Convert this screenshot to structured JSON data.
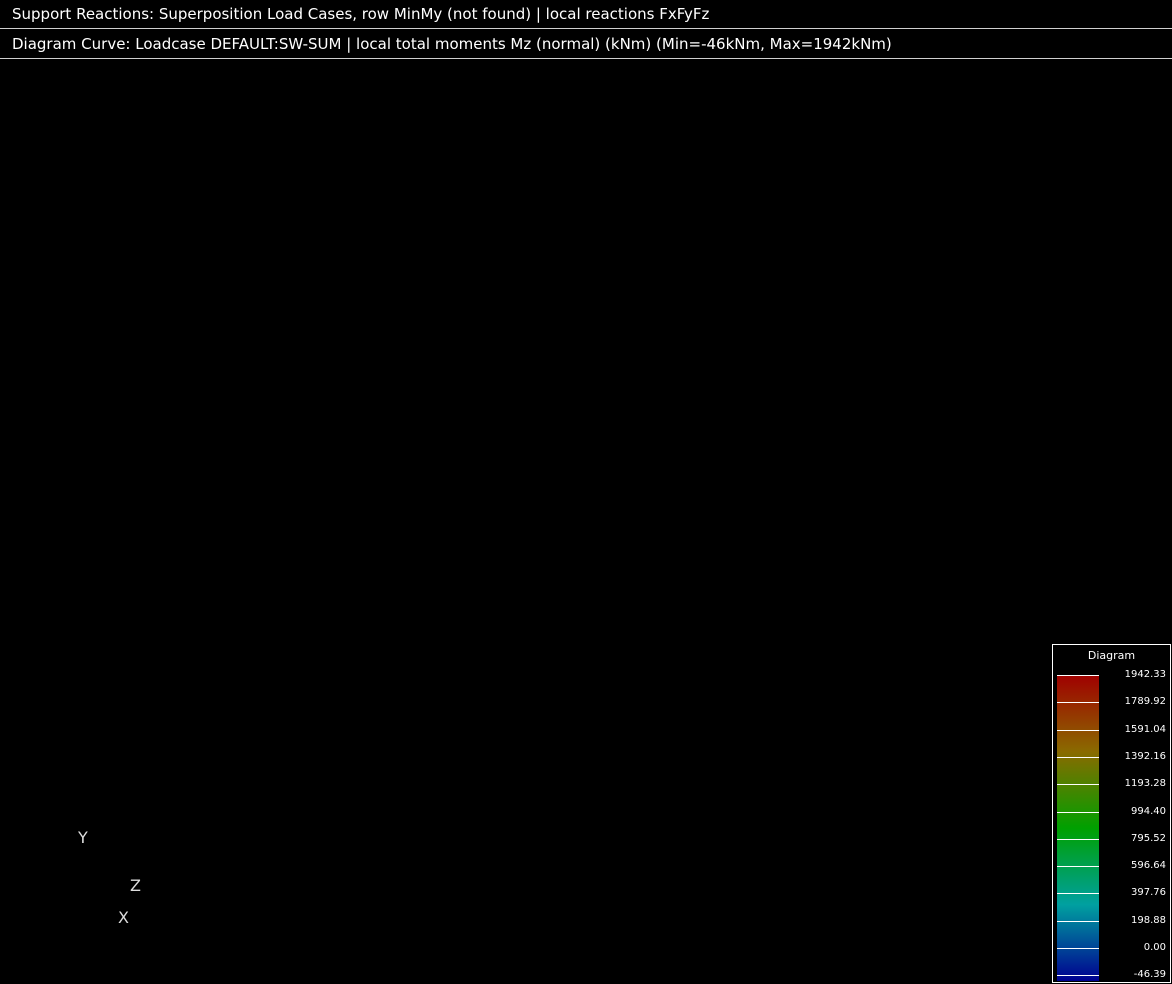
{
  "header": {
    "line1": "Support Reactions: Superposition Load Cases, row MinMy (not found) | local reactions FxFyFz",
    "line2": "Diagram Curve: Loadcase DEFAULT:SW-SUM | local total moments Mz (normal) (kNm) (Min=-46kNm, Max=1942kNm)"
  },
  "legend": {
    "title": "Diagram",
    "labels": [
      "1942.33",
      "1789.92",
      "1591.04",
      "1392.16",
      "1193.28",
      "994.40",
      "795.52",
      "596.64",
      "397.76",
      "198.88",
      "0.00",
      "-46.39"
    ],
    "colors": {
      "top": "#a00000",
      "upper": "#8a6a00",
      "middle": "#00a000",
      "lower": "#00a0a0",
      "bottom": "#000090"
    }
  },
  "axes": {
    "y": "Y",
    "z": "Z",
    "x": "X"
  }
}
